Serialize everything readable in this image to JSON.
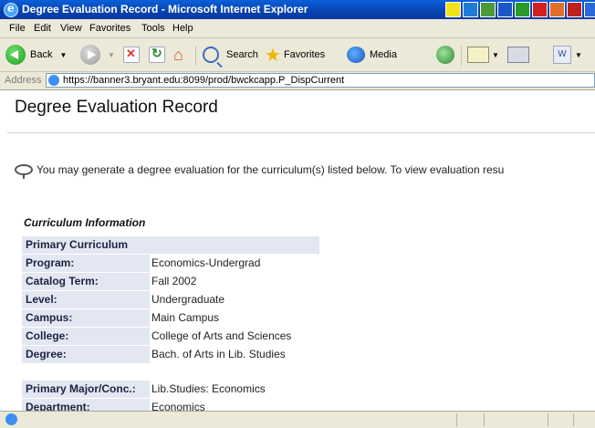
{
  "window": {
    "title": "Degree Evaluation Record - Microsoft Internet Explorer",
    "taskbar_colors": [
      "#f2e21a",
      "#1f7bd8",
      "#4a9a36",
      "#1a58c8",
      "#2a9a2a",
      "#d02020",
      "#e0702a",
      "#c02020",
      "#2a6ad8"
    ]
  },
  "menu": {
    "items": [
      "File",
      "Edit",
      "View",
      "Favorites",
      "Tools",
      "Help"
    ]
  },
  "toolbar": {
    "back_label": "Back",
    "search_label": "Search",
    "favorites_label": "Favorites",
    "media_label": "Media"
  },
  "address": {
    "label": "Address",
    "url": "https://banner3.bryant.edu:8099/prod/bwckcapp.P_DispCurrent"
  },
  "page": {
    "title": "Degree Evaluation Record",
    "info_message": "You may generate a degree evaluation for the curriculum(s) listed below. To view evaluation resu",
    "section_title": "Curriculum Information",
    "table_header": "Primary Curriculum",
    "rows": [
      {
        "label": "Program:",
        "value": "Economics-Undergrad"
      },
      {
        "label": "Catalog Term:",
        "value": "Fall 2002"
      },
      {
        "label": "Level:",
        "value": "Undergraduate"
      },
      {
        "label": "Campus:",
        "value": "Main Campus"
      },
      {
        "label": "College:",
        "value": "College of Arts and Sciences"
      },
      {
        "label": "Degree:",
        "value": "Bach. of Arts in Lib. Studies"
      }
    ],
    "major_rows": [
      {
        "label": "Primary Major/Conc.:",
        "value": "Lib.Studies: Economics"
      },
      {
        "label": "Department:",
        "value": "Economics"
      }
    ]
  }
}
